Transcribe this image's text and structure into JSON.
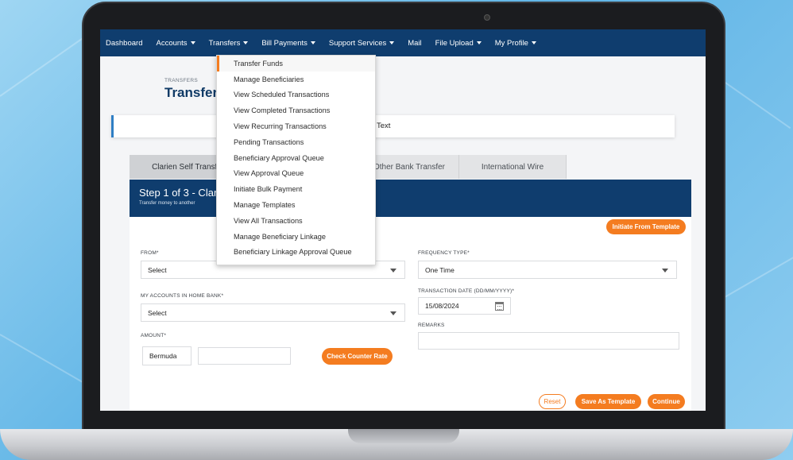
{
  "navbar": {
    "items": [
      {
        "label": "Dashboard",
        "has_caret": false
      },
      {
        "label": "Accounts",
        "has_caret": true
      },
      {
        "label": "Transfers",
        "has_caret": true
      },
      {
        "label": "Bill Payments",
        "has_caret": true
      },
      {
        "label": "Support Services",
        "has_caret": true
      },
      {
        "label": "Mail",
        "has_caret": false
      },
      {
        "label": "File Upload",
        "has_caret": true
      },
      {
        "label": "My Profile",
        "has_caret": true
      }
    ]
  },
  "transfers_menu": {
    "items": [
      "Transfer Funds",
      "Manage Beneficiaries",
      "View Scheduled Transactions",
      "View Completed Transactions",
      "View Recurring Transactions",
      "Pending Transactions",
      "Beneficiary Approval Queue",
      "View Approval Queue",
      "Initiate Bulk Payment",
      "Manage Templates",
      "View All Transactions",
      "Manage Beneficiary Linkage",
      "Beneficiary Linkage Approval Queue"
    ],
    "active_index": 0
  },
  "page": {
    "breadcrumb": "TRANSFERS",
    "title": "Transfer",
    "notice_text": "Text"
  },
  "tabs": [
    "Clarien Self Transfe",
    "",
    "Other Bank Transfer",
    "International Wire"
  ],
  "step": {
    "title": "Step 1 of 3 - Clar",
    "subtitle": "Transfer money to another"
  },
  "form": {
    "initiate_template_button": "Initiate From Template",
    "from_label": "FROM*",
    "from_value": "Select",
    "my_accounts_label": "MY ACCOUNTS IN HOME BANK*",
    "my_accounts_value": "Select",
    "amount_label": "AMOUNT*",
    "currency_value": "Bermuda",
    "amount_value": "",
    "check_rate_button": "Check Counter Rate",
    "frequency_label": "FREQUENCY TYPE*",
    "frequency_value": "One Time",
    "date_label": "TRANSACTION DATE (DD/MM/YYYY)*",
    "date_value": "15/08/2024",
    "remarks_label": "REMARKS",
    "remarks_value": "",
    "reset_button": "Reset",
    "save_template_button": "Save As Template",
    "continue_button": "Continue"
  },
  "colors": {
    "navy": "#0f3d6e",
    "accent_orange": "#f47c20",
    "link_blue": "#2f7ec4"
  }
}
